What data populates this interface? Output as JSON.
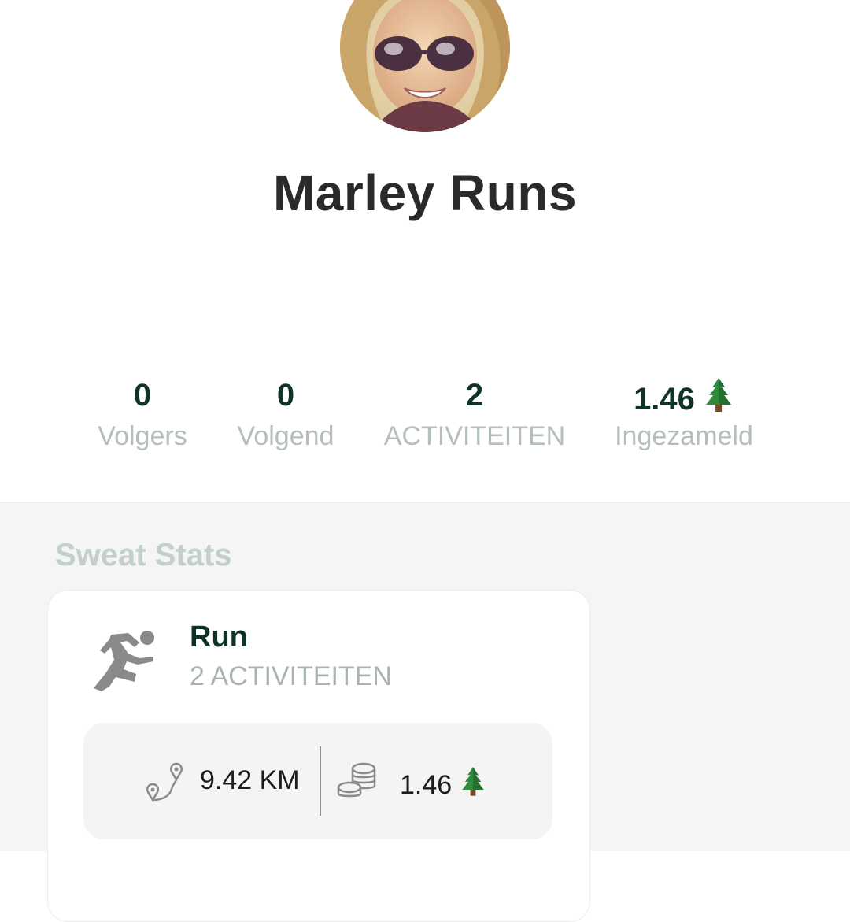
{
  "profile": {
    "name": "Marley Runs"
  },
  "stats": [
    {
      "value": "0",
      "label": "Volgers"
    },
    {
      "value": "0",
      "label": "Volgend"
    },
    {
      "value": "2",
      "label": "ACTIVITEITEN"
    },
    {
      "value": "1.46",
      "label": "Ingezameld",
      "icon": "tree-icon"
    }
  ],
  "sweat_stats": {
    "title": "Sweat Stats",
    "card": {
      "icon": "runner-icon",
      "title": "Run",
      "subtitle": "2 ACTIVITEITEN",
      "distance": "9.42 KM",
      "distance_icon": "route-icon",
      "collected": "1.46",
      "collected_icon": "coins-icon",
      "collected_unit_icon": "tree-icon"
    }
  },
  "colors": {
    "accent_dark_green": "#0f3324",
    "muted_label": "#b4bfbb",
    "section_bg": "#f5f5f5"
  }
}
